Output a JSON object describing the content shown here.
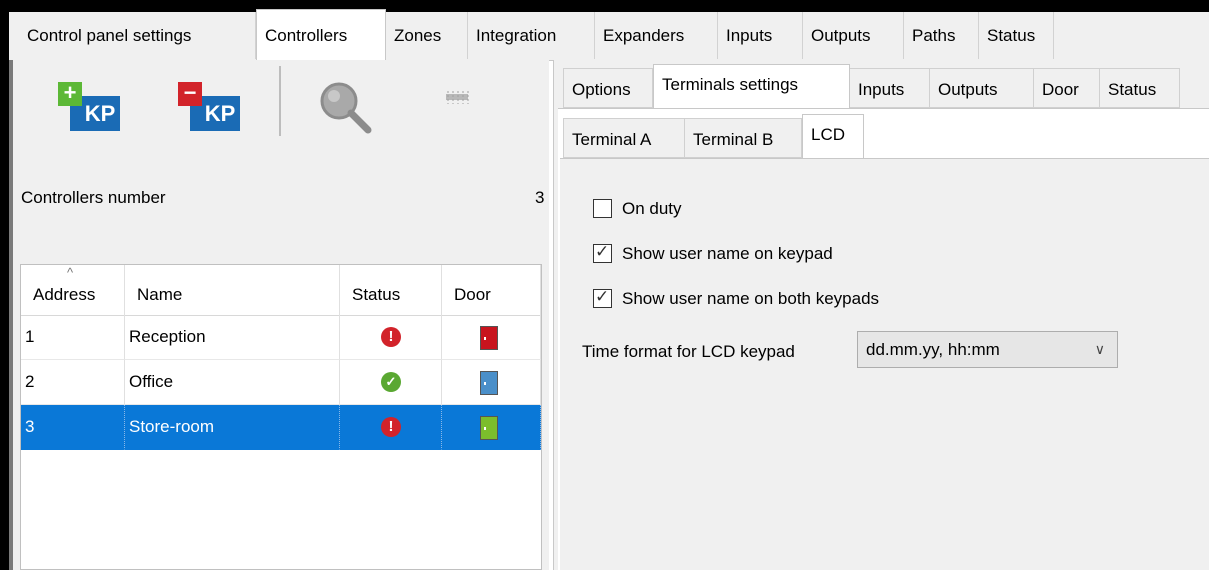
{
  "main_tabs": [
    "Control panel settings",
    "Controllers",
    "Zones",
    "Integration",
    "Expanders",
    "Inputs",
    "Outputs",
    "Paths",
    "Status"
  ],
  "active_main_tab": "Controllers",
  "toolbar": {
    "add_keypad_label": "KP",
    "remove_keypad_label": "KP",
    "add_icon": "plus-icon",
    "remove_icon": "minus-icon",
    "search_icon": "magnifier-icon",
    "module_icon": "module-icon"
  },
  "controllers": {
    "label": "Controllers number",
    "count": "3",
    "columns": [
      "Address",
      "Name",
      "Status",
      "Door"
    ],
    "sort_indicator": "^",
    "rows": [
      {
        "address": "1",
        "name": "Reception",
        "status": "error",
        "door_color": "#c8141e"
      },
      {
        "address": "2",
        "name": "Office",
        "status": "ok",
        "door_color": "#4a8fc9"
      },
      {
        "address": "3",
        "name": "Store-room",
        "status": "error",
        "door_color": "#7cbd2c"
      }
    ],
    "selected_row": 2
  },
  "sub_tabs": [
    "Options",
    "Terminals settings",
    "Inputs",
    "Outputs",
    "Door",
    "Status"
  ],
  "active_sub_tab": "Terminals settings",
  "terminal_tabs": [
    "Terminal A",
    "Terminal B",
    "LCD"
  ],
  "active_terminal_tab": "LCD",
  "lcd": {
    "on_duty": {
      "label": "On duty",
      "checked": false
    },
    "show_user_name": {
      "label": "Show user name on keypad",
      "checked": true
    },
    "show_user_name_both": {
      "label": "Show user name on both keypads",
      "checked": true
    },
    "time_format_label": "Time format for LCD keypad",
    "time_format_value": "dd.mm.yy, hh:mm"
  },
  "colors": {
    "accent": "#0a78d7",
    "error": "#d2232a",
    "ok": "#5aa832",
    "kp_blue": "#1a6bb5"
  }
}
